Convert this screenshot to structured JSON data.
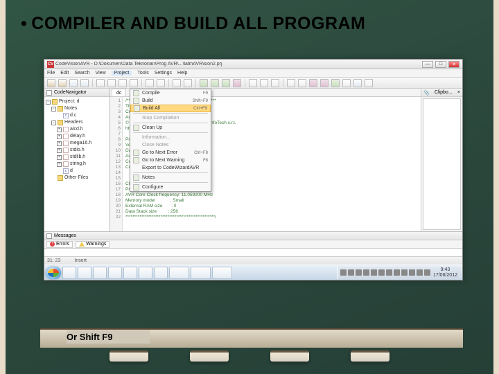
{
  "slide": {
    "bullet": "•",
    "title": "COMPILER AND BUILD ALL PROGRAM",
    "caption": "Or  Shift F9"
  },
  "window": {
    "app_icon": "CV",
    "title": "CodeVisionAVR - D:\\Dokumen\\Data Teknorian\\Prog AVR\\...\\latihAVR\\sion2.prj",
    "win_min": "—",
    "win_max": "□",
    "win_close": "✕"
  },
  "menu": [
    "File",
    "Edit",
    "Search",
    "View",
    "Project",
    "Tools",
    "Settings",
    "Help"
  ],
  "project_menu": {
    "items": [
      {
        "icon": true,
        "label": "Compile",
        "shortcut": "F9"
      },
      {
        "icon": true,
        "label": "Build",
        "shortcut": "Shift+F9"
      },
      {
        "icon": true,
        "label": "Build All",
        "shortcut": "Ctrl+F9",
        "highlight": true
      },
      {
        "sep": true
      },
      {
        "icon": false,
        "label": "Stop Compilation",
        "dis": true
      },
      {
        "sep": true
      },
      {
        "icon": true,
        "label": "Clean Up"
      },
      {
        "sep": true
      },
      {
        "icon": false,
        "label": "Information...",
        "dis": true
      },
      {
        "icon": false,
        "label": "Close Notes",
        "dis": true
      },
      {
        "icon": true,
        "label": "Go to Next Error",
        "shortcut": "Ctrl+F8"
      },
      {
        "icon": true,
        "label": "Go to Next Warning",
        "shortcut": "F8"
      },
      {
        "icon": false,
        "label": "Export to CodeWizardAVR"
      },
      {
        "sep": true
      },
      {
        "icon": true,
        "label": "Notes"
      },
      {
        "sep": true
      },
      {
        "icon": true,
        "label": "Configure"
      }
    ]
  },
  "navigator": {
    "header": "CodeNavigator",
    "tree": [
      {
        "d": 0,
        "exp": "-",
        "ic": "folder",
        "lbl": "Project: d"
      },
      {
        "d": 1,
        "exp": "-",
        "ic": "folder",
        "lbl": "Notes"
      },
      {
        "d": 2,
        "exp": " ",
        "ic": "cfile",
        "lbl": "d.c"
      },
      {
        "d": 1,
        "exp": "-",
        "ic": "folder",
        "lbl": "Headers"
      },
      {
        "d": 2,
        "exp": "+",
        "ic": "hfile",
        "lbl": "alcd.h"
      },
      {
        "d": 2,
        "exp": "+",
        "ic": "hfile",
        "lbl": "delay.h"
      },
      {
        "d": 2,
        "exp": "+",
        "ic": "hfile",
        "lbl": "mega16.h"
      },
      {
        "d": 2,
        "exp": "+",
        "ic": "hfile",
        "lbl": "stdio.h"
      },
      {
        "d": 2,
        "exp": "+",
        "ic": "hfile",
        "lbl": "stdlib.h"
      },
      {
        "d": 2,
        "exp": "+",
        "ic": "hfile",
        "lbl": "string.h"
      },
      {
        "d": 2,
        "exp": " ",
        "ic": "cfile",
        "lbl": "d"
      },
      {
        "d": 1,
        "exp": " ",
        "ic": "folder",
        "lbl": "Other Files"
      }
    ]
  },
  "clipboard": {
    "header": "Clipbo...",
    "close": "×",
    "empty": "(empty)"
  },
  "tab": {
    "label": "dc"
  },
  "code": {
    "lines": [
      {
        "n": 1,
        "t": "/***************************************************"
      },
      {
        "n": 2,
        "t": "This program was produced by the"
      },
      {
        "n": 3,
        "t": "CodeWizardAVR V2.05.3 Professional"
      },
      {
        "n": 4,
        "t": "Automatic Program Generator"
      },
      {
        "n": 5,
        "t": "© Copyright 1998-2011 Pavel Haiduc, HP InfoTech s.r.l."
      },
      {
        "n": 6,
        "t": "http://www.hpinfotech.com"
      },
      {
        "n": 7,
        "t": ""
      },
      {
        "n": 8,
        "t": "Project :"
      },
      {
        "n": 9,
        "t": "Version :"
      },
      {
        "n": 10,
        "t": "Date    : 17/06/2012"
      },
      {
        "n": 11,
        "t": "Author  :"
      },
      {
        "n": 12,
        "t": "Company :"
      },
      {
        "n": 13,
        "t": "Comments:"
      },
      {
        "n": 14,
        "t": ""
      },
      {
        "n": 15,
        "t": ""
      },
      {
        "n": 16,
        "t": "Chip type               : ATmega16"
      },
      {
        "n": 17,
        "t": "Program type            : Application"
      },
      {
        "n": 18,
        "t": "AVR Core Clock frequency: 11.059200 MHz"
      },
      {
        "n": 19,
        "t": "Memory model            : Small"
      },
      {
        "n": 20,
        "t": "External RAM size       : 0"
      },
      {
        "n": 21,
        "t": "Data Stack size         : 256"
      },
      {
        "n": 22,
        "t": "***************************************************/"
      }
    ]
  },
  "messages": {
    "errors": "Errors",
    "warnings": "Warnings",
    "header": "Messages"
  },
  "status": {
    "pos": "31: 23",
    "mode": "Insert"
  },
  "taskbar": {
    "clock_time": "9:43",
    "clock_date": "17/06/2012"
  }
}
